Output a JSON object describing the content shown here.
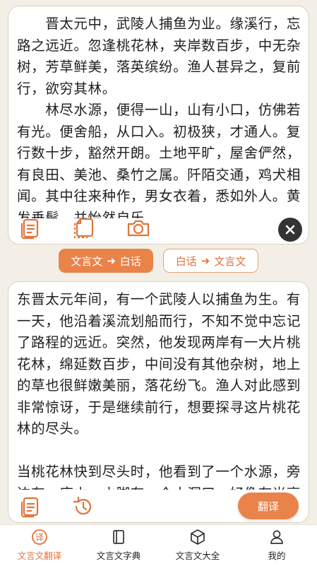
{
  "source_text": "　　晋太元中，武陵人捕鱼为业。缘溪行，忘路之远近。忽逢桃花林，夹岸数百步，中无杂树，芳草鲜美，落英缤纷。渔人甚异之，复前行，欲穷其林。\n　　林尽水源，便得一山，山有小口，仿佛若有光。便舍船，从口入。初极狭，才通人。复行数十步，豁然开朗。土地平旷，屋舍俨然，有良田、美池、桑竹之属。阡陌交通，鸡犬相闻。其中往来种作，男女衣着，悉如外人。黄发垂髫，并怡然自乐。\n　　见渔人，乃大惊，问所从来。具答",
  "translation_text": "东晋太元年间，有一个武陵人以捕鱼为生。有一天，他沿着溪流划船而行，不知不觉中忘记了路程的远近。突然，他发现两岸有一大片桃花林，绵延数百步，中间没有其他杂树，地上的草也很鲜嫩美丽，落花纷飞。渔人对此感到非常惊讶，于是继续前行，想要探寻这片桃花林的尽头。\n\n当桃花林快到尽头时，他看到了一个水源，旁边有一座山。山脚有一个小洞口，好像有光亮透出。渔人就放下船，从洞口进去。一开始洞口非常狭窄，只能容一个",
  "mode_buttons": {
    "classical_to_modern": {
      "from": "文言文",
      "arrow": "➜",
      "to": "白话"
    },
    "modern_to_classical": {
      "from": "白话",
      "arrow": "➜",
      "to": "文言文"
    }
  },
  "translate_button": "翻译",
  "tabs": [
    {
      "label": "文言文翻译",
      "icon": "translate-icon",
      "active": true
    },
    {
      "label": "文言文字典",
      "icon": "book-icon",
      "active": false
    },
    {
      "label": "文言文大全",
      "icon": "box-icon",
      "active": false
    },
    {
      "label": "我的",
      "icon": "person-icon",
      "active": false
    }
  ],
  "colors": {
    "accent": "#e9834a",
    "background": "#f3efe6"
  }
}
